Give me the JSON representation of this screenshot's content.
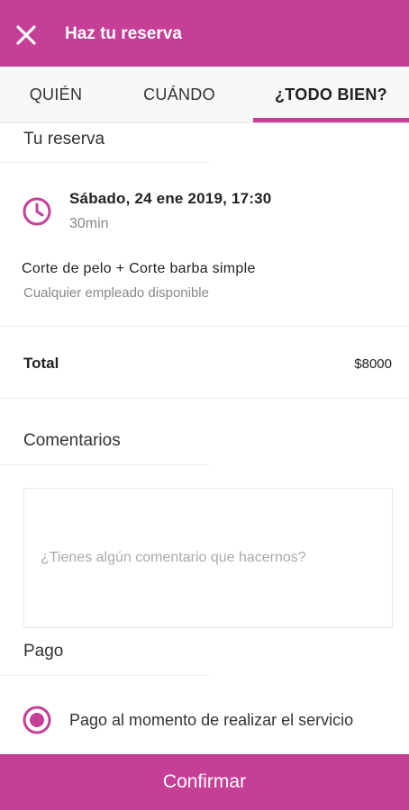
{
  "header": {
    "title": "Haz tu reserva",
    "close_icon": "close-icon"
  },
  "tabs": [
    {
      "label": "QUIÉN",
      "active": false
    },
    {
      "label": "CUÁNDO",
      "active": false
    },
    {
      "label": "¿TODO BIEN?",
      "active": true
    }
  ],
  "reservation": {
    "section_title": "Tu reserva",
    "datetime": "Sábado, 24 ene 2019, 17:30",
    "duration": "30min",
    "service": "Corte de pelo + Corte barba simple",
    "employee": "Cualquier empleado disponible",
    "icon": "clock-icon"
  },
  "total": {
    "label": "Total",
    "value": "$8000"
  },
  "comments": {
    "section_title": "Comentarios",
    "placeholder": "¿Tienes algún comentario que hacernos?",
    "value": ""
  },
  "payment": {
    "section_title": "Pago",
    "option_label": "Pago al momento de realizar el servicio",
    "selected": true
  },
  "confirm_label": "Confirmar",
  "colors": {
    "accent": "#c53f97",
    "muted_text": "#888888"
  }
}
